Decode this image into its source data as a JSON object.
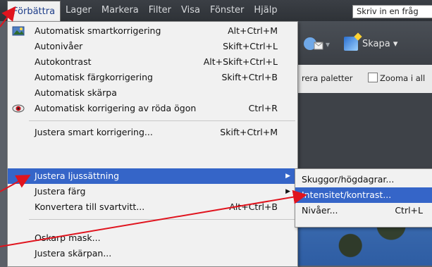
{
  "menubar": {
    "items": [
      "Förbättra",
      "Lager",
      "Markera",
      "Filter",
      "Visa",
      "Fönster",
      "Hjälp"
    ],
    "search_text": "Skriv in en fråg"
  },
  "toolbar": {
    "create_label": "Skapa ▾",
    "share_arrow": "▾",
    "palettes_label": "rera paletter",
    "zoom_label": "Zooma i all"
  },
  "menu": {
    "items": [
      {
        "label": "Automatisk smartkorrigering",
        "shortcut": "Alt+Ctrl+M",
        "icon": "auto-smart-fix-icon"
      },
      {
        "label": "Autonivåer",
        "shortcut": "Skift+Ctrl+L"
      },
      {
        "label": "Autokontrast",
        "shortcut": "Alt+Skift+Ctrl+L"
      },
      {
        "label": "Automatisk färgkorrigering",
        "shortcut": "Skift+Ctrl+B"
      },
      {
        "label": "Automatisk skärpa",
        "shortcut": ""
      },
      {
        "label": "Automatisk korrigering av röda ögon",
        "shortcut": "Ctrl+R",
        "icon": "red-eye-icon"
      },
      {
        "label": "Justera smart korrigering...",
        "shortcut": "Skift+Ctrl+M"
      },
      {
        "label": "Justera ljussättning",
        "shortcut": "",
        "submenu": true,
        "highlighted": true
      },
      {
        "label": "Justera färg",
        "shortcut": "",
        "submenu": true
      },
      {
        "label": "Konvertera till svartvitt...",
        "shortcut": "Alt+Ctrl+B"
      },
      {
        "label": "Oskarp mask...",
        "shortcut": ""
      },
      {
        "label": "Justera skärpan...",
        "shortcut": ""
      }
    ]
  },
  "submenu": {
    "items": [
      {
        "label": "Skuggor/högdagrar...",
        "shortcut": ""
      },
      {
        "label": "Intensitet/kontrast...",
        "shortcut": "",
        "highlighted": true
      },
      {
        "label": "Nivåer...",
        "shortcut": "Ctrl+L"
      }
    ]
  },
  "colors": {
    "highlight": "#3565c8",
    "annotation": "#e0141e"
  }
}
